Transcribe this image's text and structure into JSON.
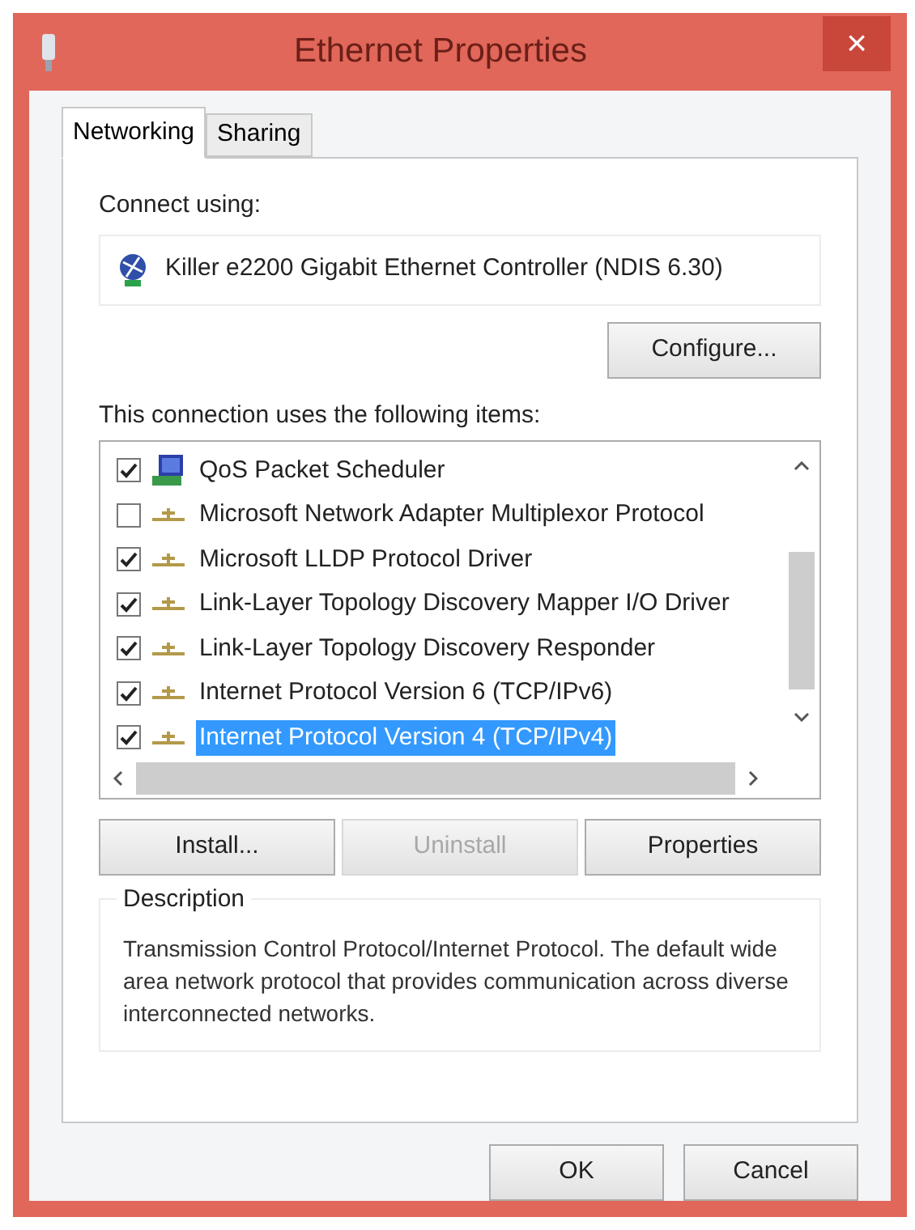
{
  "window": {
    "title": "Ethernet Properties",
    "close": "×"
  },
  "tabs": [
    {
      "label": "Networking",
      "selected": true
    },
    {
      "label": "Sharing",
      "selected": false
    }
  ],
  "connect_label": "Connect using:",
  "adapter": "Killer e2200 Gigabit Ethernet Controller (NDIS 6.30)",
  "configure_button": "Configure...",
  "items_label": "This connection uses the following items:",
  "items": [
    {
      "kind": "scheduler",
      "label": "QoS Packet Scheduler",
      "checked": true,
      "selected": false
    },
    {
      "kind": "protocol",
      "label": "Microsoft Network Adapter Multiplexor Protocol",
      "checked": false,
      "selected": false
    },
    {
      "kind": "protocol",
      "label": "Microsoft LLDP Protocol Driver",
      "checked": true,
      "selected": false
    },
    {
      "kind": "protocol",
      "label": "Link-Layer Topology Discovery Mapper I/O Driver",
      "checked": true,
      "selected": false
    },
    {
      "kind": "protocol",
      "label": "Link-Layer Topology Discovery Responder",
      "checked": true,
      "selected": false
    },
    {
      "kind": "protocol",
      "label": "Internet Protocol Version 6 (TCP/IPv6)",
      "checked": true,
      "selected": false
    },
    {
      "kind": "protocol",
      "label": "Internet Protocol Version 4 (TCP/IPv4)",
      "checked": true,
      "selected": true
    }
  ],
  "item_buttons": [
    {
      "label": "Install...",
      "disabled": false
    },
    {
      "label": "Uninstall",
      "disabled": true
    },
    {
      "label": "Properties",
      "disabled": false
    }
  ],
  "description": {
    "title": "Description",
    "text": "Transmission Control Protocol/Internet Protocol. The default wide area network protocol that provides communication across diverse interconnected networks."
  },
  "dialog_buttons": [
    "OK",
    "Cancel"
  ]
}
